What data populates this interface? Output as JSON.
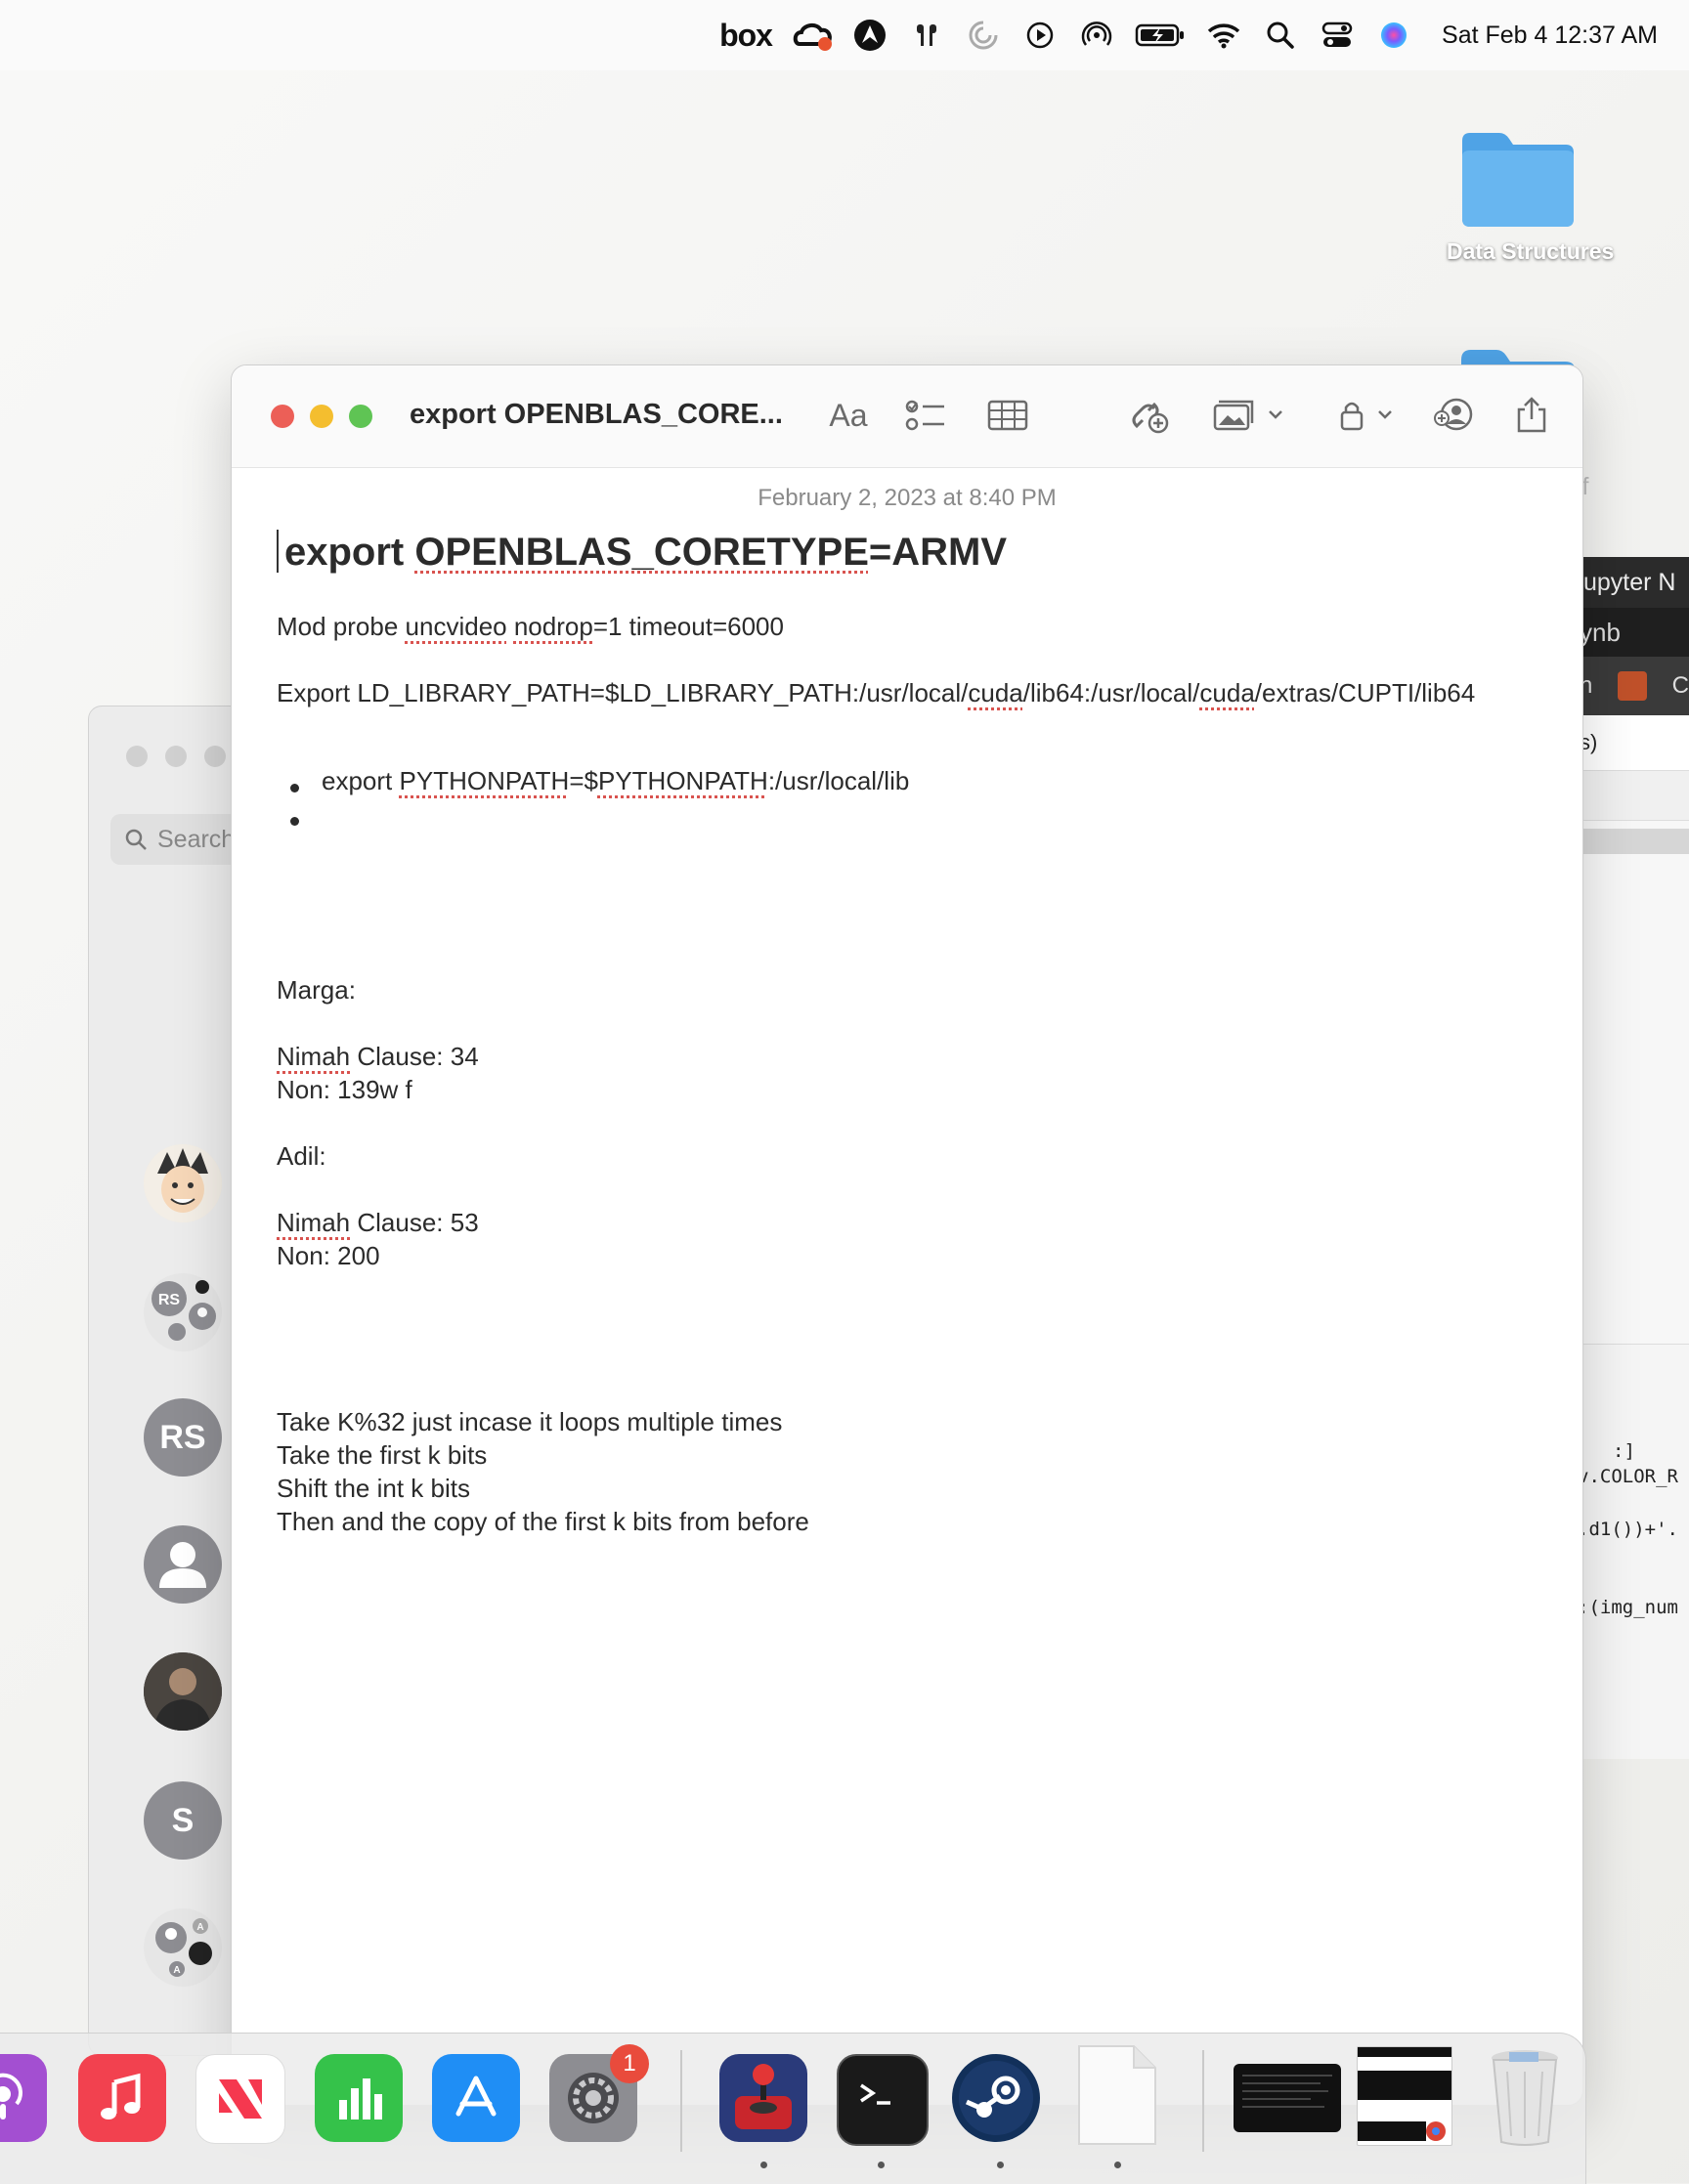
{
  "menubar": {
    "box_label": "box",
    "datetime": "Sat Feb 4  12:37 AM",
    "icons": [
      "box-icon",
      "creative-cloud-icon",
      "cursor-app-icon",
      "airpods-icon",
      "loading-icon",
      "play-icon",
      "airdrop-icon",
      "battery-charging-icon",
      "wifi-icon",
      "search-icon",
      "control-center-icon",
      "siri-icon"
    ]
  },
  "desktop": {
    "folder_label": "Data Structures",
    "partial_label": "ff"
  },
  "jupyter": {
    "title_fragment": "upyter N",
    "tab_fragment": "ynb",
    "row3_a": "n",
    "row3_b": "C",
    "row4": "s)",
    "code": [
      ":]",
      "v.COLOR_R",
      ".d1())+'.",
      ":(img_num"
    ]
  },
  "messages": {
    "search_placeholder": "Search",
    "avatars": [
      "RS",
      "RS",
      "S",
      "A",
      "A"
    ]
  },
  "notes": {
    "toolbar_title": "export OPENBLAS_CORE...",
    "format_label": "Aa",
    "date": "February 2, 2023 at 8:40 PM",
    "heading_pre": "export ",
    "heading_sp": "OPENBLAS_CORETYPE",
    "heading_post": "=ARMV",
    "line1": {
      "a": "Mod probe ",
      "b": "uncvideo",
      "c": " ",
      "d": "nodrop",
      "e": "=1 timeout=6000"
    },
    "line2": {
      "a": "Export LD_LIBRARY_PATH=$LD_LIBRARY_PATH:/usr/local/",
      "b": "cuda",
      "c": "/lib64:/usr/local/",
      "d": "cuda",
      "e": "/extras/CUPTI/lib64"
    },
    "bullet1": {
      "a": "export ",
      "b": "PYTHONPATH",
      "c": "=$",
      "d": "PYTHONPATH",
      "e": ":/usr/local/lib"
    },
    "marga": "Marga:",
    "marga_clause_sp": "Nimah",
    "marga_clause_rest": " Clause: 34",
    "marga_non": "Non: 139w f",
    "adil": "Adil:",
    "adil_clause_sp": "Nimah",
    "adil_clause_rest": " Clause: 53",
    "adil_non": "Non: 200",
    "todo": [
      "Take K%32 just incase it loops multiple times",
      "Take the first k bits",
      "Shift the int k bits",
      "Then and the copy of the first k bits from before"
    ]
  },
  "dock": {
    "settings_badge": "1",
    "apps": [
      "podcasts-icon",
      "music-icon",
      "news-icon",
      "numbers-icon",
      "app-store-icon",
      "system-settings-icon",
      "joystick-app-icon",
      "terminal-icon",
      "steam-icon",
      "document-icon",
      "window-thumbnail-icon",
      "chrome-window-thumbnail-icon",
      "trash-icon"
    ]
  }
}
